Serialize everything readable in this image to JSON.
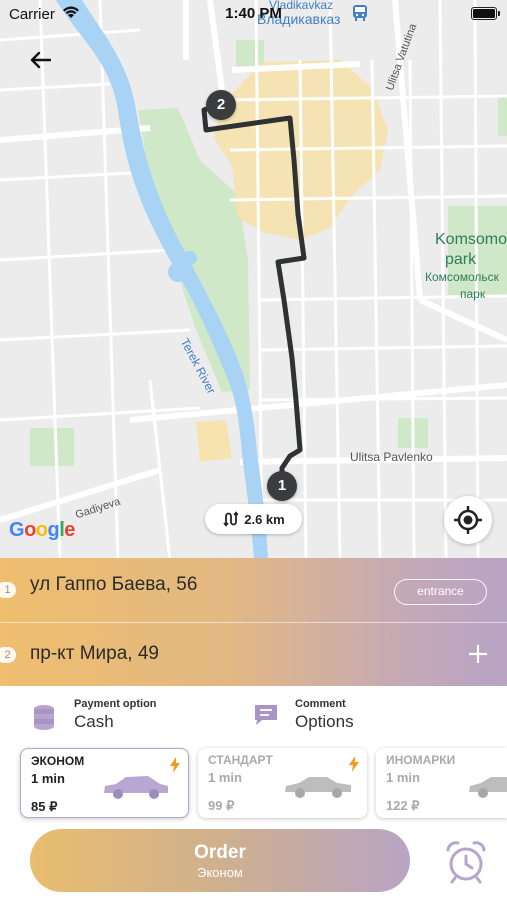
{
  "status_bar": {
    "carrier": "Carrier",
    "time": "1:40 PM"
  },
  "map": {
    "labels": {
      "vladikavkaz_lat": "Vladikavkaz",
      "vladikavkaz_cyr": "Владикавказ",
      "vatutina": "Ulitsa Vatutina",
      "park_en_1": "Komsomo",
      "park_en_2": "park",
      "park_ru_1": "Комсомольск",
      "park_ru_2": "парк",
      "terek": "Terek River",
      "pavlenko": "Ulitsa Pavlenko",
      "gadiyeva": "Gadiyeva"
    },
    "markers": {
      "start": "1",
      "end": "2"
    },
    "distance": "2.6 km",
    "google": [
      "G",
      "o",
      "o",
      "g",
      "l",
      "e"
    ],
    "google_colors": [
      "#4285F4",
      "#EA4335",
      "#FBBC05",
      "#4285F4",
      "#34A853",
      "#EA4335"
    ]
  },
  "addresses": [
    {
      "index": "1",
      "text": "ул Гаппо Баева, 56",
      "action": "entrance"
    },
    {
      "index": "2",
      "text": "пр-кт Мира, 49"
    }
  ],
  "options": {
    "payment": {
      "label": "Payment option",
      "value": "Cash",
      "icon": "coins-icon"
    },
    "comment": {
      "label": "Comment",
      "value": "Options",
      "icon": "chat-icon"
    }
  },
  "tariffs": [
    {
      "name": "ЭКОНОМ",
      "time": "1 min",
      "price": "85 ₽",
      "selected": true
    },
    {
      "name": "СТАНДАРТ",
      "time": "1 min",
      "price": "99 ₽",
      "selected": false
    },
    {
      "name": "ИНОМАРКИ",
      "time": "1 min",
      "price": "122 ₽",
      "selected": false
    }
  ],
  "order": {
    "title": "Order",
    "subtitle": "Эконом"
  },
  "colors": {
    "route": "#2f3133",
    "marker": "#3a3c3e",
    "accent_gold": "#e9bd6f",
    "accent_lilac": "#b8a4c4",
    "car_selected": "#b9a7d3",
    "car_dim": "#bdbdbd",
    "bolt": "#f29b1e"
  }
}
